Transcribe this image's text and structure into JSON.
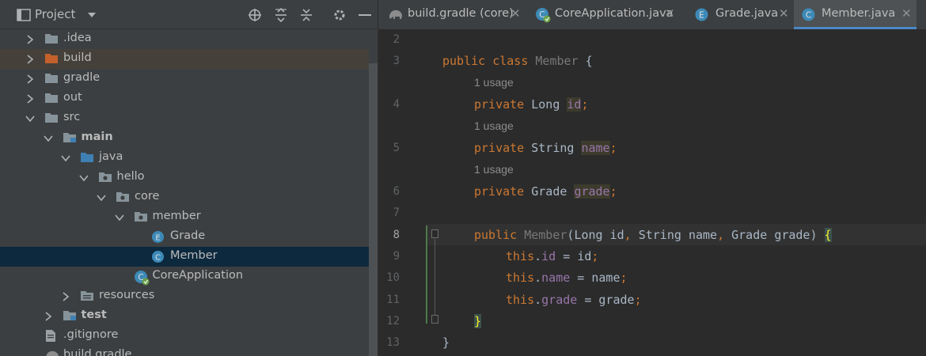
{
  "project_panel": {
    "title": "Project",
    "icons": [
      "project-window-icon",
      "dropdown-chevron-icon",
      "locate-target-icon",
      "expand-all-icon",
      "collapse-all-icon",
      "gear-icon",
      "minimize-icon"
    ]
  },
  "tree": [
    {
      "label": ".idea",
      "depth": 0,
      "icon": "folder",
      "expanded": false,
      "bold": false
    },
    {
      "label": "build",
      "depth": 0,
      "icon": "folder-orange",
      "expanded": false,
      "bold": false,
      "highlighted": true
    },
    {
      "label": "gradle",
      "depth": 0,
      "icon": "folder",
      "expanded": false,
      "bold": false
    },
    {
      "label": "out",
      "depth": 0,
      "icon": "folder",
      "expanded": false,
      "bold": false
    },
    {
      "label": "src",
      "depth": 0,
      "icon": "folder",
      "expanded": true,
      "bold": false
    },
    {
      "label": "main",
      "depth": 1,
      "icon": "module-folder",
      "expanded": true,
      "bold": true
    },
    {
      "label": "java",
      "depth": 2,
      "icon": "source-folder",
      "expanded": true,
      "bold": false
    },
    {
      "label": "hello",
      "depth": 3,
      "icon": "package-folder",
      "expanded": true,
      "bold": false
    },
    {
      "label": "core",
      "depth": 4,
      "icon": "package-folder",
      "expanded": true,
      "bold": false
    },
    {
      "label": "member",
      "depth": 5,
      "icon": "package-folder",
      "expanded": true,
      "bold": false
    },
    {
      "label": "Grade",
      "depth": 6,
      "icon": "enum-file",
      "expanded": null,
      "bold": false
    },
    {
      "label": "Member",
      "depth": 6,
      "icon": "class-file",
      "expanded": null,
      "bold": false,
      "selected": true
    },
    {
      "label": "CoreApplication",
      "depth": 5,
      "icon": "spring-class-file",
      "expanded": null,
      "bold": false
    },
    {
      "label": "resources",
      "depth": 2,
      "icon": "resources-folder",
      "expanded": false,
      "bold": false
    },
    {
      "label": "test",
      "depth": 1,
      "icon": "module-folder",
      "expanded": false,
      "bold": true
    },
    {
      "label": ".gitignore",
      "depth": 0,
      "icon": "text-file",
      "expanded": null,
      "bold": false
    },
    {
      "label": "build.gradle",
      "depth": 0,
      "icon": "gradle-file",
      "expanded": null,
      "bold": false
    }
  ],
  "tabs": [
    {
      "label": "build.gradle (core)",
      "icon": "gradle-elephant-icon",
      "active": false
    },
    {
      "label": "CoreApplication.java",
      "icon": "spring-class-icon",
      "active": false
    },
    {
      "label": "Grade.java",
      "icon": "enum-icon",
      "active": false
    },
    {
      "label": "Member.java",
      "icon": "class-icon",
      "active": true
    }
  ],
  "editor": {
    "line_numbers": [
      "2",
      "3",
      "4",
      "5",
      "6",
      "7",
      "8",
      "9",
      "10",
      "11",
      "12",
      "13"
    ],
    "current_line": "8",
    "usage_hint": "1 usage",
    "lines": [
      {
        "n": "2",
        "text": ""
      },
      {
        "n": "3",
        "text": "public class Member {"
      },
      {
        "n": "4",
        "text": "private Long id;"
      },
      {
        "n": "5",
        "text": "private String name;"
      },
      {
        "n": "6",
        "text": "private Grade grade;"
      },
      {
        "n": "7",
        "text": ""
      },
      {
        "n": "8",
        "text": "public Member(Long id, String name, Grade grade) {"
      },
      {
        "n": "9",
        "text": "this.id = id;"
      },
      {
        "n": "10",
        "text": "this.name = name;"
      },
      {
        "n": "11",
        "text": "this.grade = grade;"
      },
      {
        "n": "12",
        "text": "}"
      },
      {
        "n": "13",
        "text": "}"
      }
    ],
    "tokens": {
      "kw_public": "public",
      "kw_class": "class",
      "kw_private": "private",
      "kw_this": "this",
      "class_name": "Member",
      "type_long": "Long",
      "type_string": "String",
      "type_grade": "Grade",
      "field_id": "id",
      "field_name": "name",
      "field_grade": "grade",
      "open_brace": "{",
      "close_brace": "}"
    }
  },
  "colors": {
    "panel_bg": "#3c3f41",
    "editor_bg": "#2b2b2b",
    "selection": "#0d293e",
    "keyword": "#cc7832",
    "field": "#9876aa",
    "text": "#a9b7c6",
    "tab_underline": "#4a88c7"
  }
}
